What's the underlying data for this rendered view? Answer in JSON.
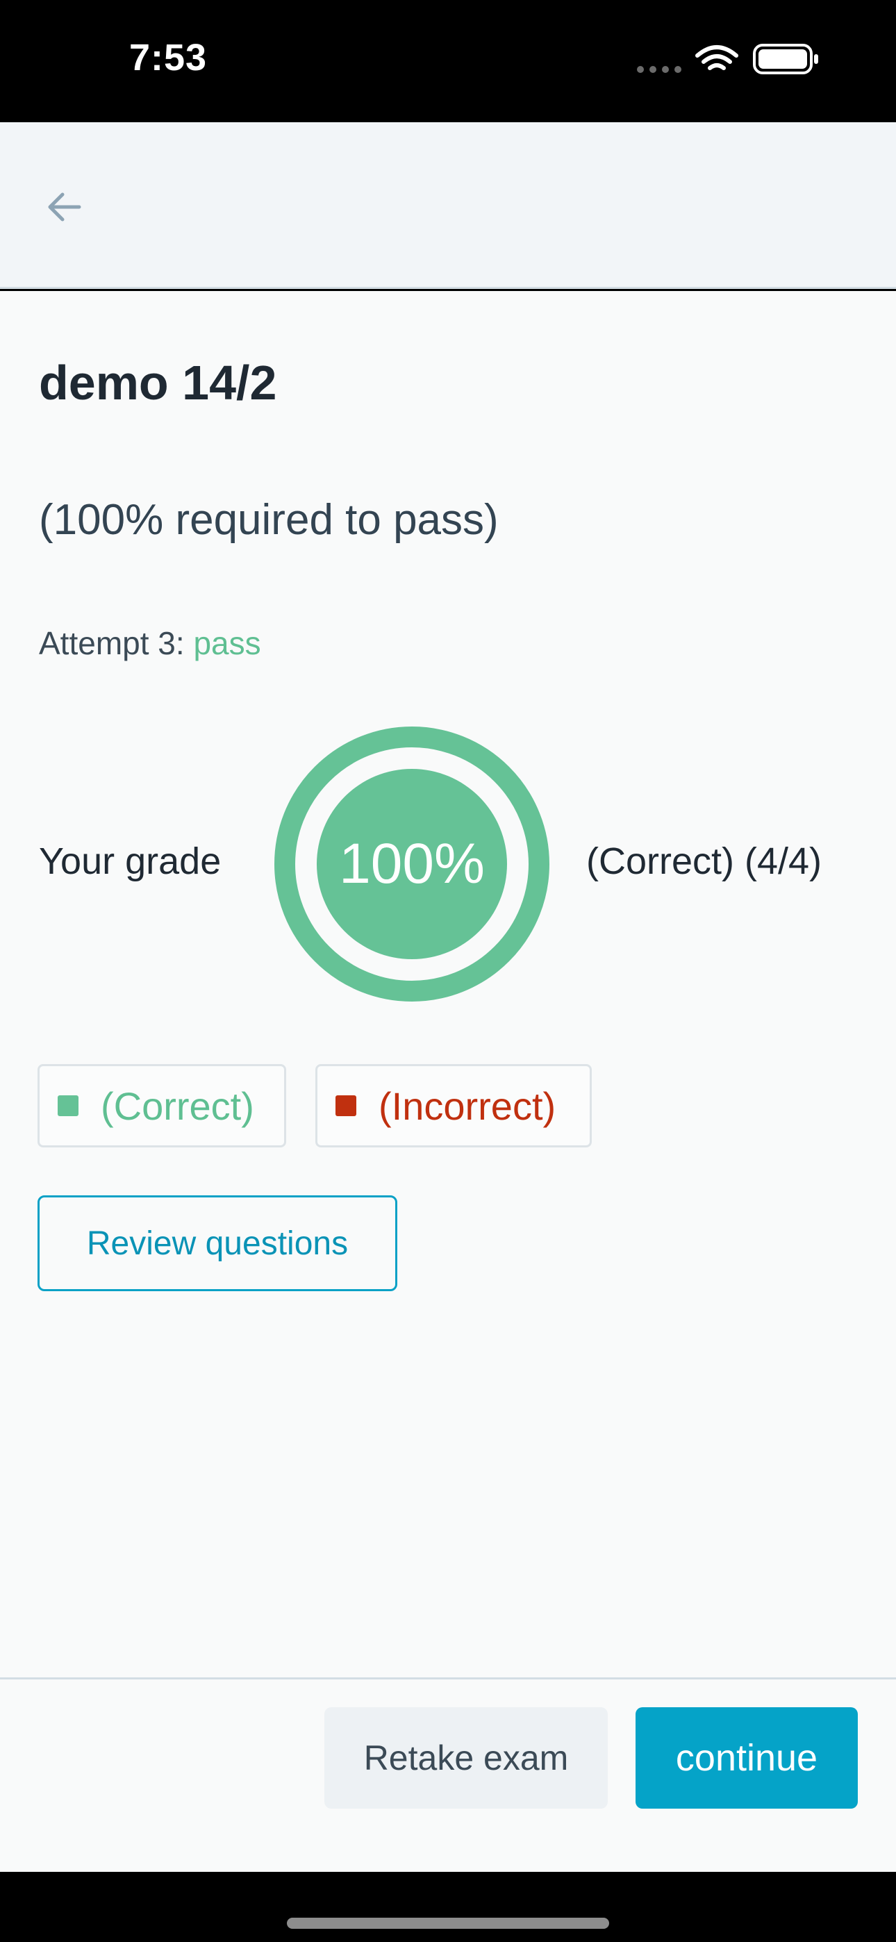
{
  "status_bar": {
    "time": "7:53",
    "icons": [
      "signal-dots-icon",
      "wifi-icon",
      "battery-icon"
    ]
  },
  "header": {
    "back_icon": "arrow-left-icon"
  },
  "exam": {
    "title": "demo 14/2",
    "pass_requirement": "(100% required to pass)",
    "attempt_label": "Attempt 3: ",
    "attempt_result": "pass",
    "grade_label": "Your grade",
    "grade_percent": "100%",
    "grade_fraction": 1.0,
    "grade_detail": "(Correct) (4/4)"
  },
  "legend": {
    "correct_label": "(Correct)",
    "incorrect_label": "(Incorrect)"
  },
  "actions": {
    "review_label": "Review questions",
    "retake_label": "Retake exam",
    "continue_label": "continue"
  },
  "colors": {
    "correct": "#65c296",
    "incorrect": "#c0300f",
    "accent": "#05a3c8",
    "header_bg": "#f2f5f8",
    "page_bg": "#f9fafa"
  }
}
